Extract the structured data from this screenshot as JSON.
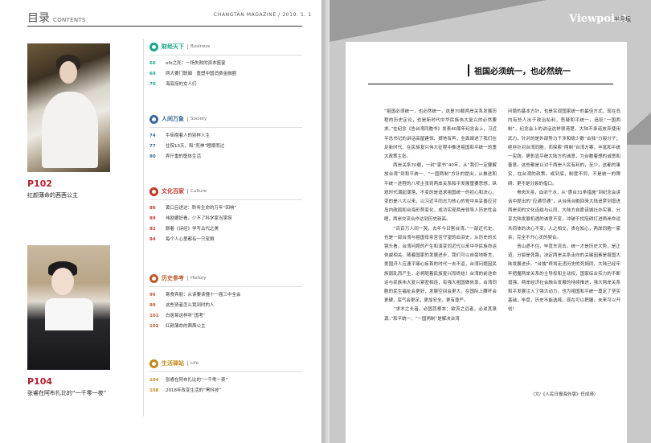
{
  "toc": {
    "title": "目录",
    "title_en": "CONTENTS",
    "magazine": "CHANGTAN MAGAZINE / 2019. 1. 1"
  },
  "features": [
    {
      "page": "P102",
      "caption": "红颜薄命的茜茜公主"
    },
    {
      "page": "P104",
      "caption": "张睿在阿布扎比的“一千零一夜”"
    }
  ],
  "sections": [
    {
      "title": "财经天下",
      "title_en": "Business",
      "color": "#1aa88a",
      "items": [
        {
          "num": "66",
          "text": "ofo之死：一场失败的资本盛宴"
        },
        {
          "num": "68",
          "text": "两大要门联姻　重塑中国消费金融圈"
        },
        {
          "num": "70",
          "text": "海底捞的女人们"
        }
      ]
    },
    {
      "title": "人间万象",
      "title_en": "Society",
      "color": "#3b6b9a",
      "items": [
        {
          "num": "74",
          "text": "牛街攒着人的别样人生"
        },
        {
          "num": "77",
          "text": "住院13天，和“死神”瞪眼而过"
        },
        {
          "num": "80",
          "text": "弄斤重的堕体生活"
        }
      ]
    },
    {
      "title": "文化百家",
      "title_en": "Culture",
      "color": "#c0392b",
      "items": [
        {
          "num": "86",
          "text": "黄口吕进达：聆听生命的万年“回响”"
        },
        {
          "num": "89",
          "text": "伟励要好看，少不了科学家当掌捞"
        },
        {
          "num": "92",
          "text": "聊着《诗经》学写古代之美"
        },
        {
          "num": "94",
          "text": "每个人心里都有一只宠狮"
        }
      ]
    },
    {
      "title": "历史参考",
      "title_en": "History",
      "color": "#c05a2b",
      "items": [
        {
          "num": "96",
          "text": "寒食宾朋：从读要读懂十一届三中全会"
        },
        {
          "num": "99",
          "text": "这些贤者怎么我到时的人"
        },
        {
          "num": "101",
          "text": "白居易这样听“国考”"
        },
        {
          "num": "102",
          "text": "红颜薄命的茜茜公主"
        }
      ]
    },
    {
      "title": "生活驿站",
      "title_en": "Life",
      "color": "#c28a1a",
      "items": [
        {
          "num": "104",
          "text": "张睿在阿布扎比的“一千零一夜”"
        },
        {
          "num": "108",
          "text": "2018年改变生活的“黑科技”"
        }
      ]
    }
  ],
  "viewpoint": {
    "logo": "Viewpoint",
    "subtitle": "半月坛"
  },
  "article": {
    "title": "祖国必须统一，也必然统一",
    "col_left": "“祖国必须统一，也必然统一，这是70载两岸关系发展历程的历史定论，也是新时代中华民族伟大复兴的必然要求。”在纪念《告台湾同胞书》发表40周年纪念会上，习近平总书记的讲话高屋建瓴、掷地有声，全面阐述了我们在足新时代、在民族复兴伟大征程中推进祖国和平统一的重大政策主张。\n　　两岸关系70载，一封“家书”40年，从“我们一定要解放台湾”到和平统一、“一国两制”方针的提出，从推进和平统一进程的八项主张到两岸关系和平发展重要思想，纵观时代潮起潮落，不变的是追求祖国统一的初心和决心，变的是八大以来，以习近平同志为核心的党中央妥善应对岛内政局和台海形势变化，成功实现两岸领导人历史性会晤，两岸交流合作达到历史新高。\n　　“百百万人同一哭，去年今日割台湾。”一部近代史，也是一部台湾与祖国母亲苦苦守望的血泪史，从历史的长镜头看，台湾问题的产生和演变同近代以来中华民族命运休戚相关。随着国家的发展进步，我们可以自豪地断言，爱国济人应速平痛心疾首的时代一去不返，台湾问题因民族弱乱而产生，必将随着民族复兴而终结！台湾的前途命运与民族伟大复兴紧密相连，有强大祖国做依靠，台湾同胞的民生福祉会更好，发展空间会更大，在国际上腰杆会更硬，底气会更足，更加安全，更有尊严。\n　　“求木之长者，必固其根本；欲流之远者，必浚其泉源。”和平统一、“一国两制”是解决台湾",
    "col_right": "问题的基本方针，也是实现国家统一的最佳方式，现在岛内有些人出于政治私利，恶疑和平统一，追贬“一国两制”，纪念会上的讲话这样很清楚，大陆不承诺放弃使用武力，针对的是外部势力干涉和极少数“台独”分裂分子；绝非针对台湾同胞，而探索“两制”台湾方案，丰富和平统一实践，更彰显平统大陆方的诚意，为台胞着想的诚意和善意。这些都是以对于两岸人民有利的，至少，这都的事实，在台湾的政策，或到底，制度不同，不是统一的障碍，更不是分裂的借口。\n　　骨肉天亲，血浓于水，从“惠台31条措施”到纪念会讲话中提出的“应通尽通”，从台商台胞回来大陆追梦到增进两岸间的文化连结与认同，大陆方自愿该城社办实事，分享大陆发展机遇的诚意不变，冲破干扰阻碍打进两岸命运共同体的决心不变。人之相交，贵在知心，两岸同胞一家亲，完全不开心灵的契合。\n　　青山遮不住，毕竟东流去。统一才是历史大势，是正道，分裂是死路，决定两岸关系走向的关键因素是祖国大陆发展进步。“台独”终将走违历史的死胡同，大陆已经牢牢把握两岸关系的主导权和主动权，国家综合实力的不断增强，两岸经济社会融合发展的持续推进，强大两岸关系和平发展注入了强大动力，也为祖国和平统一奠定了坚实基础，毕竟，历史不能选择，现在可以把握，未来可以开创！",
    "source": "（文/《人民日报海外版》任成琦）"
  }
}
